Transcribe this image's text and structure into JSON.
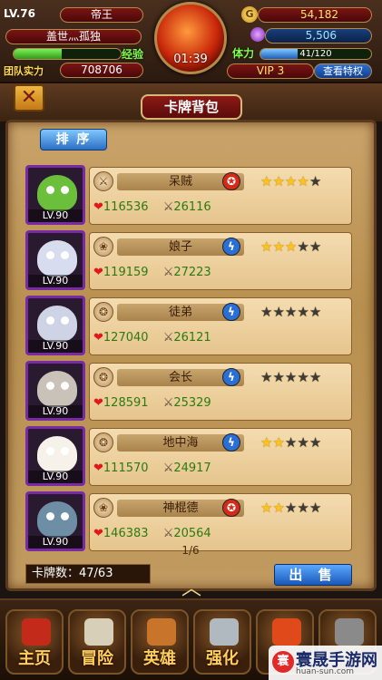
{
  "hud": {
    "level": "LV.76",
    "rank": "帝王",
    "player_name": "盖世灬孤独",
    "exp_label": "经验",
    "exp_fraction": 0.45,
    "power_label": "团队实力",
    "power_value": "708706",
    "timer": "01:39",
    "gold": "54,182",
    "gems": "5,506",
    "stamina_label": "体力",
    "stamina_value": "41/120",
    "stamina_fraction": 0.34,
    "vip": "VIP 3",
    "vip_privilege_button": "查看特权"
  },
  "header": {
    "title": "卡牌背包",
    "close_icon": "close-icon",
    "sort_button": "排 序"
  },
  "cards": [
    {
      "name": "呆贼",
      "level": "LV.90",
      "hp": "116536",
      "atk": "26116",
      "stars": 4,
      "elem": "fire",
      "elem_glyph": "✪",
      "class_glyph": "⚔",
      "face": "#6bbf3a"
    },
    {
      "name": "娘子",
      "level": "LV.90",
      "hp": "119159",
      "atk": "27223",
      "stars": 3,
      "elem": "lightning",
      "elem_glyph": "ϟ",
      "class_glyph": "❀",
      "face": "#d8dcef"
    },
    {
      "name": "徒弟",
      "level": "LV.90",
      "hp": "127040",
      "atk": "26121",
      "stars": 0,
      "elem": "lightning",
      "elem_glyph": "ϟ",
      "class_glyph": "❂",
      "face": "#cfd3e6"
    },
    {
      "name": "会长",
      "level": "LV.90",
      "hp": "128591",
      "atk": "25329",
      "stars": 0,
      "elem": "lightning",
      "elem_glyph": "ϟ",
      "class_glyph": "❂",
      "face": "#c9c2b8"
    },
    {
      "name": "地中海",
      "level": "LV.90",
      "hp": "111570",
      "atk": "24917",
      "stars": 2,
      "elem": "lightning",
      "elem_glyph": "ϟ",
      "class_glyph": "❂",
      "face": "#f6f2ea"
    },
    {
      "name": "神棍德",
      "level": "LV.90",
      "hp": "146383",
      "atk": "20564",
      "stars": 2,
      "elem": "fire",
      "elem_glyph": "✪",
      "class_glyph": "❀",
      "face": "#6e8ea6"
    }
  ],
  "footer": {
    "card_count": "卡牌数：47/63",
    "page": "1/6",
    "sell_button": "出 售"
  },
  "nav": [
    {
      "label": "主页",
      "icon": "home-icon",
      "color": "#c42a1a"
    },
    {
      "label": "冒险",
      "icon": "skull-icon",
      "color": "#d7cfb8"
    },
    {
      "label": "英雄",
      "icon": "helmet-icon",
      "color": "#c8742a"
    },
    {
      "label": "强化",
      "icon": "hammer-icon",
      "color": "#b0b8c0"
    },
    {
      "label": "",
      "icon": "flame-icon",
      "color": "#e04a1a"
    },
    {
      "label": "",
      "icon": "gear-icon",
      "color": "#8a8a8a"
    }
  ],
  "watermark": {
    "title": "寰晟手游网",
    "url": "huan-sun.com"
  },
  "colors": {
    "star_on": "#ffc21a",
    "star_off": "#3b3b3b",
    "fire": "#d62a18",
    "lightning": "#2a6fd6"
  }
}
